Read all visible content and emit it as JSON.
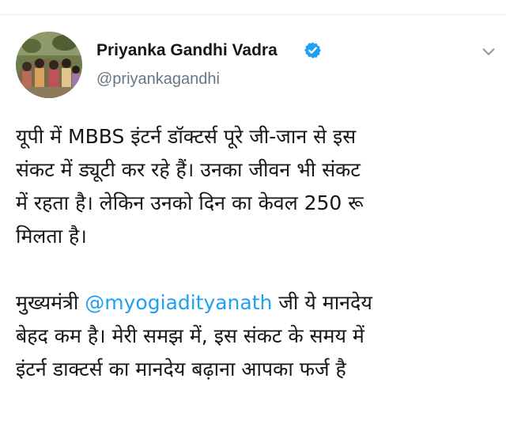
{
  "author": {
    "name": "Priyanka Gandhi Vadra",
    "handle": "@priyankagandhi",
    "verified": true
  },
  "icons": {
    "verified": "verified-badge-icon",
    "more": "chevron-down-icon"
  },
  "colors": {
    "link": "#1da1f2",
    "text": "#14171a",
    "secondary": "#657786"
  },
  "tweet": {
    "paragraph1": [
      "यूपी में MBBS इंटर्न डॉक्टर्स पूरे जी-जान से इस",
      "संकट में ड्यूटी कर रहे हैं। उनका जीवन भी संकट",
      "में रहता है। लेकिन उनको दिन का केवल 250 रू",
      "मिलता है।"
    ],
    "paragraph2": {
      "line1_prefix": "मुख्यमंत्री ",
      "mention": "@myogiadityanath",
      "line1_suffix": " जी ये मानदेय",
      "line2": "बेहद कम है। मेरी समझ में, इस संकट के समय में",
      "line3": "इंटर्न डाक्टर्स का मानदेय बढ़ाना आपका फर्ज है"
    }
  }
}
